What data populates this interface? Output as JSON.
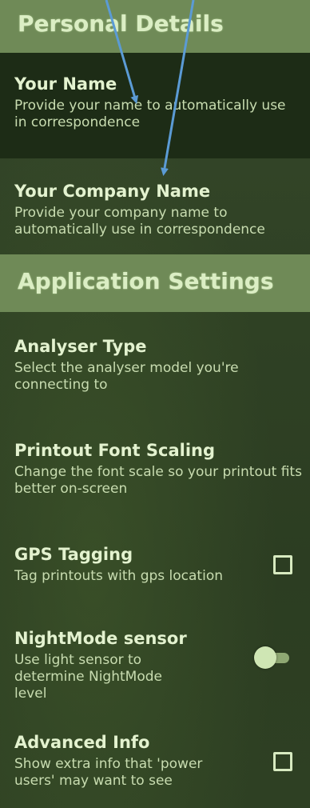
{
  "sections": {
    "personal": {
      "header": "Personal Details",
      "items": [
        {
          "title": "Your Name",
          "desc": "Provide your name to automatically use in correspondence"
        },
        {
          "title": "Your Company Name",
          "desc": "Provide your company name to automatically use in correspondence"
        }
      ]
    },
    "app": {
      "header": "Application Settings",
      "items": [
        {
          "title": "Analyser Type",
          "desc": "Select the analyser model you're connecting to"
        },
        {
          "title": "Printout Font Scaling",
          "desc": "Change the font scale so your printout fits better on-screen"
        },
        {
          "title": "GPS Tagging",
          "desc": "Tag printouts with gps location",
          "control": "checkbox",
          "checked": false
        },
        {
          "title": "NightMode sensor",
          "desc": "Use light sensor to determine NightMode level",
          "control": "toggle",
          "on": true
        },
        {
          "title": "Advanced Info",
          "desc": "Show extra info that 'power users' may want to see",
          "control": "checkbox",
          "checked": false
        }
      ]
    }
  },
  "colors": {
    "header_bg": "#6f8a57",
    "text": "#d9ebc3",
    "arrow": "#5b9bd5"
  }
}
